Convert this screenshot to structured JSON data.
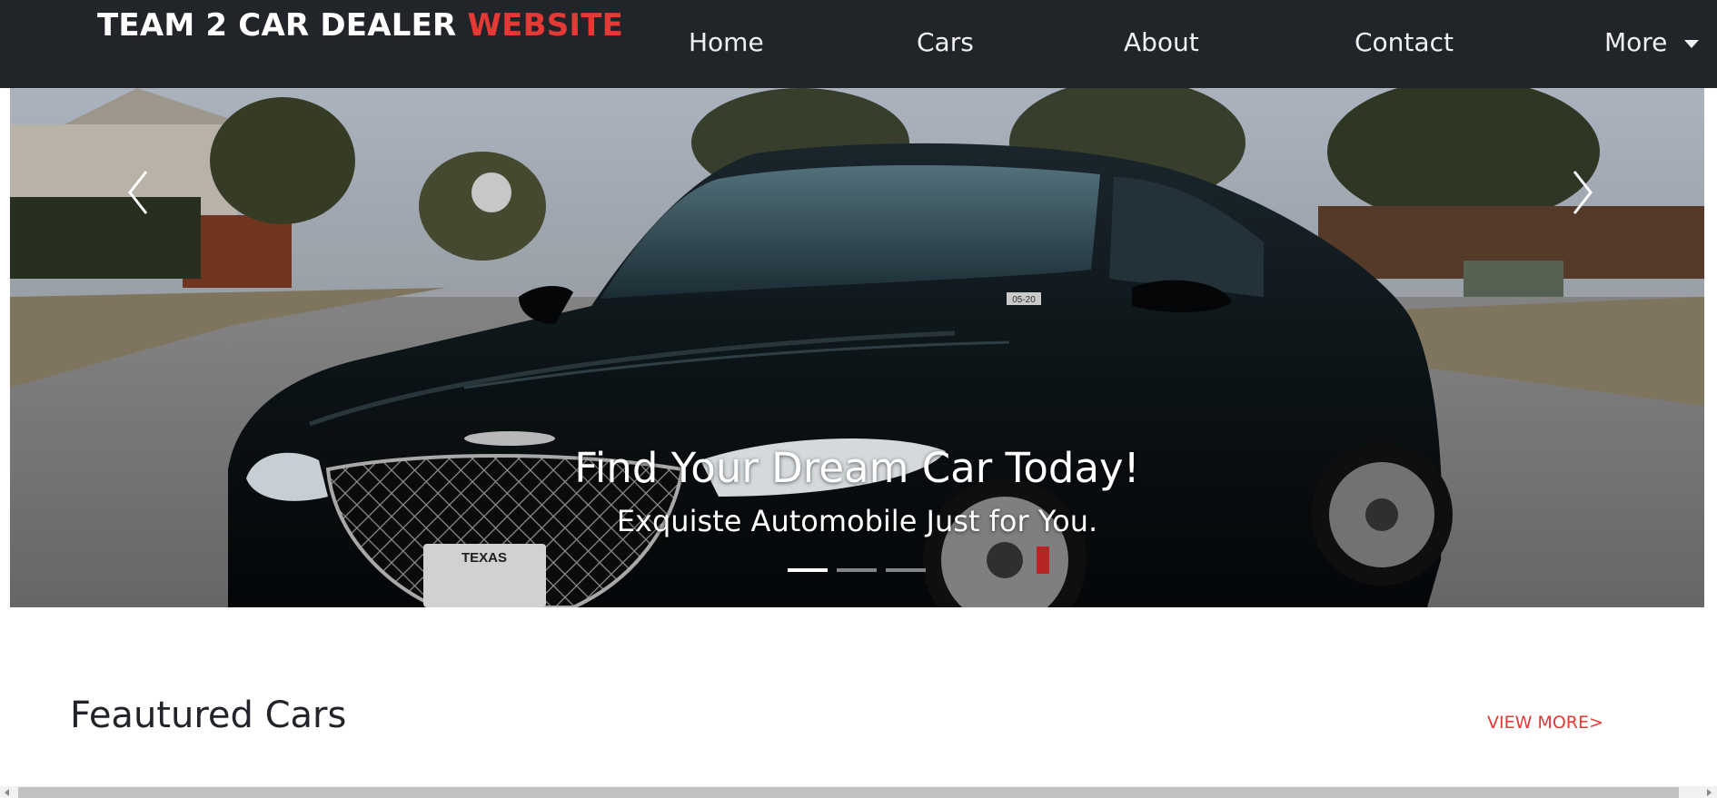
{
  "brand": {
    "part1": "TEAM 2 CAR DEALER ",
    "part2": "WEBSITE"
  },
  "nav": {
    "items": [
      {
        "label": "Home"
      },
      {
        "label": "Cars"
      },
      {
        "label": "About"
      },
      {
        "label": "Contact"
      },
      {
        "label": "More"
      }
    ]
  },
  "hero": {
    "title": "Find Your Dream Car Today!",
    "subtitle": "Exquiste Automobile Just for You.",
    "slide_count": 3,
    "active_slide": 1,
    "prev_icon": "chevron-left-icon",
    "next_icon": "chevron-right-icon",
    "image": "black-sedan-photo",
    "plate_text": "TEXAS",
    "sticker_text": "05-20"
  },
  "featured": {
    "title": "Feautured Cars",
    "view_more": "VIEW MORE>"
  },
  "colors": {
    "navbar": "#212529",
    "accent": "#e53935",
    "text": "#212529"
  }
}
